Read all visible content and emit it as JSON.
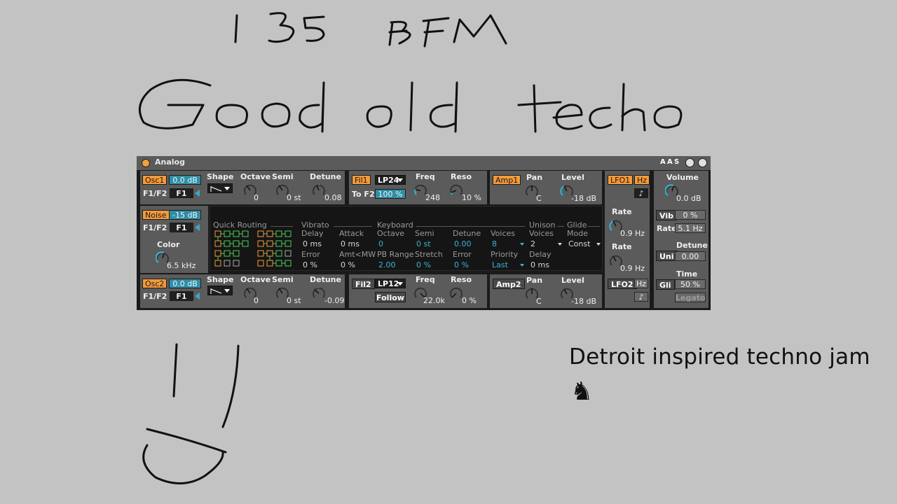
{
  "device": {
    "title": "Analog",
    "header_buttons": [
      "A",
      "A",
      "S"
    ],
    "osc1": {
      "label": "Osc1",
      "level": "0.0 dB",
      "route_label": "F1/F2",
      "route_value": "F1",
      "shape_label": "Shape",
      "octave_label": "Octave",
      "octave_value": "0",
      "semi_label": "Semi",
      "semi_value": "0 st",
      "detune_label": "Detune",
      "detune_value": "0.08"
    },
    "noise": {
      "label": "Noise",
      "level": "-15 dB",
      "route_label": "F1/F2",
      "route_value": "F1",
      "color_label": "Color",
      "color_value": "6.5 kHz"
    },
    "osc2": {
      "label": "Osc2",
      "level": "0.0 dB",
      "route_label": "F1/F2",
      "route_value": "F1",
      "shape_label": "Shape",
      "octave_label": "Octave",
      "octave_value": "0",
      "semi_label": "Semi",
      "semi_value": "0 st",
      "detune_label": "Detune",
      "detune_value": "-0.09"
    },
    "fil1": {
      "label": "Fil1",
      "type": "LP24",
      "to_label": "To F2",
      "to_value": "100 %",
      "freq_label": "Freq",
      "freq_value": "248",
      "reso_label": "Reso",
      "reso_value": "10 %"
    },
    "fil2": {
      "label": "Fil2",
      "type": "LP12",
      "follow": "Follow",
      "freq_label": "Freq",
      "freq_value": "22.0k",
      "reso_label": "Reso",
      "reso_value": "0 %"
    },
    "amp1": {
      "label": "Amp1",
      "pan_label": "Pan",
      "pan_value": "C",
      "level_label": "Level",
      "level_value": "-18 dB"
    },
    "amp2": {
      "label": "Amp2",
      "pan_label": "Pan",
      "pan_value": "C",
      "level_label": "Level",
      "level_value": "-18 dB"
    },
    "lfo1": {
      "label": "LFO1",
      "hz": "Hz",
      "note_icon": "♪",
      "rate1_label": "Rate",
      "rate1_value": "0.9 Hz",
      "rate2_label": "Rate",
      "rate2_value": "0.9 Hz"
    },
    "lfo2": {
      "label": "LFO2",
      "hz": "Hz",
      "note_icon": "♪"
    },
    "global": {
      "volume_label": "Volume",
      "volume_value": "0.0 dB",
      "vib_label": "Vib",
      "vib_value": "0 %",
      "rate_label": "Rate",
      "rate_value": "5.1 Hz",
      "uni_label": "Uni",
      "detune_label": "Detune",
      "detune_value": "0.00",
      "gli_label": "Gli",
      "time_label": "Time",
      "time_value": "50 %",
      "legato": "Legato"
    },
    "display": {
      "quick_routing": "Quick Routing",
      "vibrato": "Vibrato",
      "vib_delay_label": "Delay",
      "vib_delay_value": "0 ms",
      "vib_attack_label": "Attack",
      "vib_attack_value": "0 ms",
      "vib_error_label": "Error",
      "vib_error_value": "0 %",
      "vib_amt_label": "Amt<MW",
      "vib_amt_value": "0 %",
      "keyboard": "Keyboard",
      "octave_label": "Octave",
      "octave_value": "0",
      "semi_label": "Semi",
      "semi_value": "0 st",
      "detune_label": "Detune",
      "detune_value": "0.00",
      "pbrange_label": "PB Range",
      "pbrange_value": "2.00",
      "stretch_label": "Stretch",
      "stretch_value": "0 %",
      "error_label": "Error",
      "error_value": "0 %",
      "voices_label": "Voices",
      "voices_value": "8",
      "priority_label": "Priority",
      "priority_value": "Last",
      "unison": "Unison",
      "uni_voices_label": "Voices",
      "uni_voices_value": "2",
      "uni_delay_label": "Delay",
      "uni_delay_value": "0 ms",
      "glide": "Glide",
      "mode_label": "Mode",
      "mode_value": "Const"
    }
  },
  "handwriting": {
    "bpm": "135 BPM",
    "title": "Good old techo"
  },
  "caption": "Detroit inspired techno jam",
  "horse_icon": "♞"
}
